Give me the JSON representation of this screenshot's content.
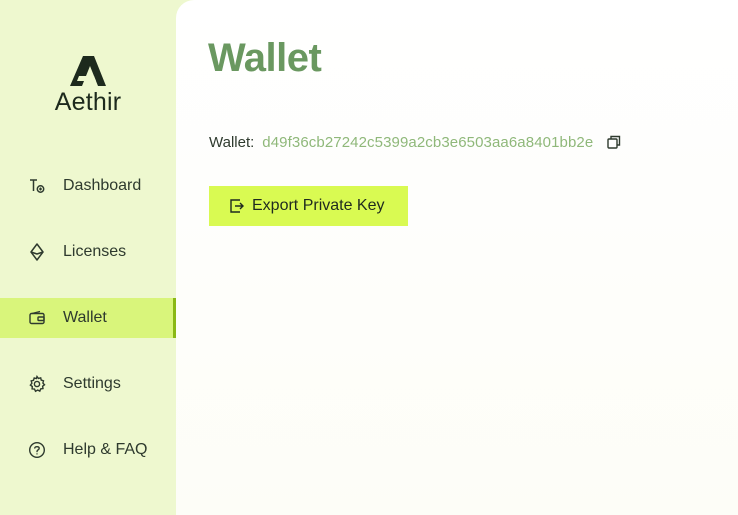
{
  "brand": {
    "name": "Aethir"
  },
  "sidebar": {
    "items": [
      {
        "label": "Dashboard",
        "icon": "dashboard-icon",
        "active": false
      },
      {
        "label": "Licenses",
        "icon": "diamond-icon",
        "active": false
      },
      {
        "label": "Wallet",
        "icon": "wallet-icon",
        "active": true
      },
      {
        "label": "Settings",
        "icon": "gear-icon",
        "active": false
      },
      {
        "label": "Help & FAQ",
        "icon": "help-circle-icon",
        "active": false
      }
    ]
  },
  "main": {
    "title": "Wallet",
    "wallet_label": "Wallet:",
    "wallet_address": "d49f36cb27242c5399a2cb3e6503aa6a8401bb2e",
    "export_button_label": "Export Private Key"
  },
  "colors": {
    "sidebar_bg": "#eef8cf",
    "accent": "#d9fa52",
    "active_indicator": "#8ab816",
    "title": "#6a9860",
    "address": "#8fb87a"
  }
}
